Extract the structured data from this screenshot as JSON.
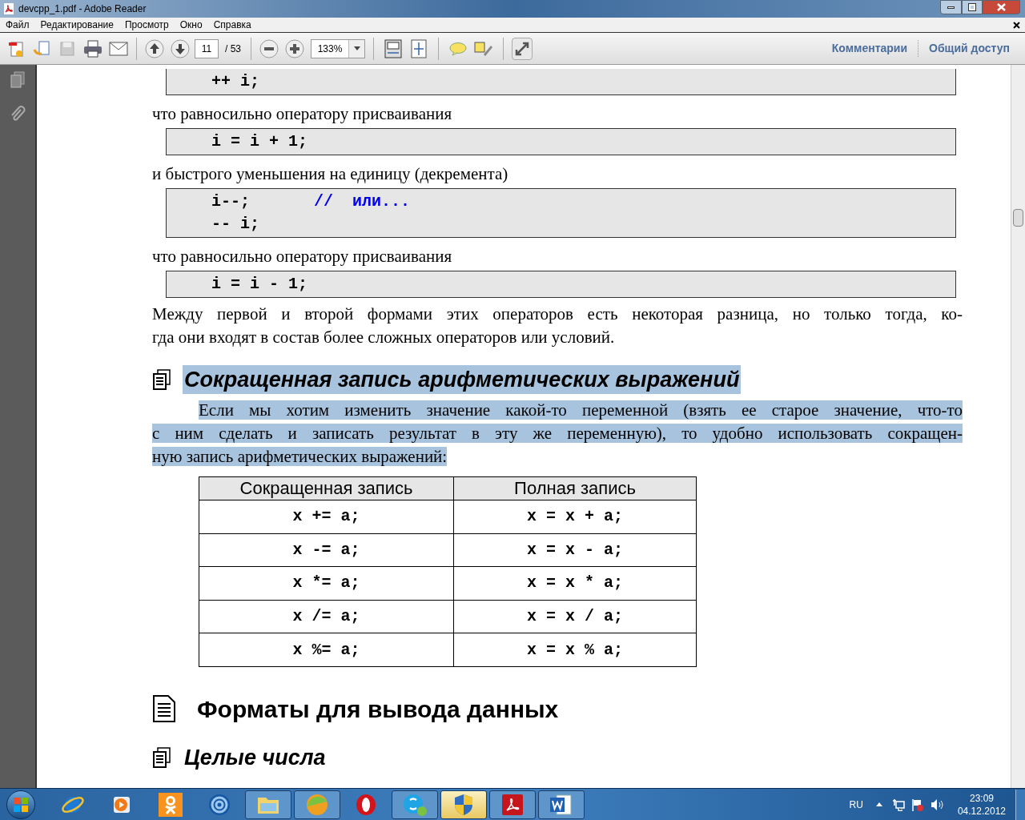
{
  "window": {
    "title": "devcpp_1.pdf - Adobe Reader"
  },
  "menu": [
    "Файл",
    "Редактирование",
    "Просмотр",
    "Окно",
    "Справка"
  ],
  "toolbar": {
    "page": "11",
    "page_total": "/ 53",
    "zoom": "133%",
    "links": [
      "Комментарии",
      "Общий доступ"
    ]
  },
  "document": [
    {
      "kind": "code",
      "lines": [
        [
          {
            "kind": "code",
            "text": "++ i;"
          }
        ]
      ]
    },
    {
      "kind": "text",
      "text": "что равносильно оператору присваивания"
    },
    {
      "kind": "code",
      "lines": [
        [
          {
            "kind": "code",
            "text": "i = i + 1;"
          }
        ]
      ]
    },
    {
      "kind": "text",
      "text": "и быстрого уменьшения на единицу (декремента)"
    },
    {
      "kind": "code",
      "lines": [
        [
          {
            "kind": "code",
            "text": "i--;"
          },
          {
            "kind": "comment",
            "text": "//  или..."
          }
        ],
        [
          {
            "kind": "code",
            "text": "-- i;"
          }
        ]
      ]
    },
    {
      "kind": "text",
      "text": "что равносильно оператору присваивания"
    },
    {
      "kind": "code",
      "lines": [
        [
          {
            "kind": "code",
            "text": "i = i - 1;"
          }
        ]
      ]
    },
    {
      "kind": "paragraph",
      "highlighted": false,
      "lines": [
        "Между первой и второй формами этих операторов есть некоторая разница, но только тогда, ко-",
        "гда они входят в состав более сложных операторов или условий."
      ]
    },
    {
      "kind": "subheading",
      "highlighted": true,
      "text": "Сокращенная запись арифметических выражений"
    },
    {
      "kind": "paragraph",
      "highlighted": true,
      "lines": [
        "Если мы хотим изменить значение какой-то переменной (взять ее старое значение, что-то",
        "с ним сделать и записать результат в эту же переменную), то удобно использовать сокращен-",
        "ную запись арифметических выражений:"
      ]
    },
    {
      "kind": "table",
      "columns": [
        "Сокращенная запись",
        "Полная запись"
      ],
      "rows": [
        [
          "x += a;",
          "x = x + a;"
        ],
        [
          "x -= a;",
          "x = x - a;"
        ],
        [
          "x *= a;",
          "x = x * a;"
        ],
        [
          "x /= a;",
          "x = x / a;"
        ],
        [
          "x %= a;",
          "x = x % a;"
        ]
      ]
    },
    {
      "kind": "heading",
      "text": "Форматы для вывода данных"
    },
    {
      "kind": "subheading",
      "highlighted": false,
      "text": "Целые числа"
    }
  ],
  "taskbar": {
    "items": [
      {
        "kind": "ie",
        "open": false,
        "selected": false
      },
      {
        "kind": "player",
        "open": false,
        "selected": false
      },
      {
        "kind": "ok",
        "open": false,
        "selected": false
      },
      {
        "kind": "mail",
        "open": false,
        "selected": false
      },
      {
        "kind": "folder",
        "open": true,
        "selected": false
      },
      {
        "kind": "ball",
        "open": true,
        "selected": false
      },
      {
        "kind": "opera",
        "open": false,
        "selected": false
      },
      {
        "kind": "skype",
        "open": true,
        "selected": false
      },
      {
        "kind": "shield",
        "open": true,
        "selected": true
      },
      {
        "kind": "acrobat",
        "open": true,
        "selected": false
      },
      {
        "kind": "word",
        "open": true,
        "selected": false
      }
    ],
    "language": "RU",
    "time": "23:09",
    "date": "04.12.2012"
  }
}
